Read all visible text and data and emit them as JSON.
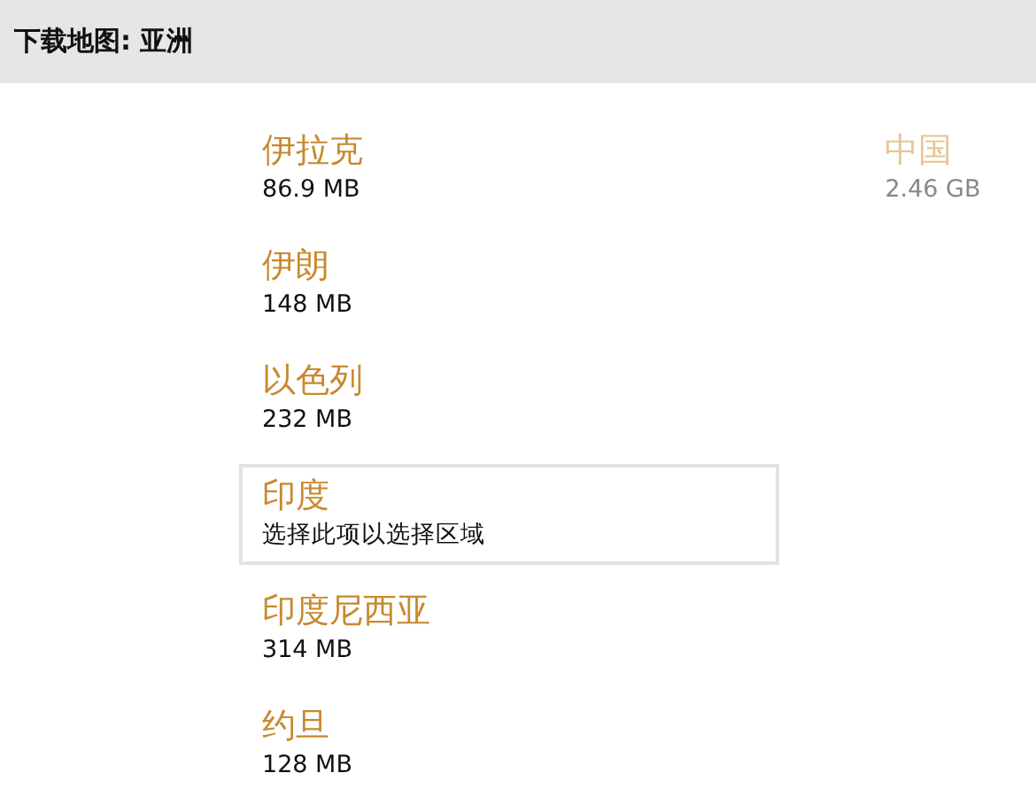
{
  "header": {
    "title": "下载地图: 亚洲"
  },
  "columns": [
    {
      "items": [
        {
          "name": "伊拉克",
          "detail": "86.9 MB",
          "selected": false,
          "disabled": false
        },
        {
          "name": "伊朗",
          "detail": "148 MB",
          "selected": false,
          "disabled": false
        },
        {
          "name": "以色列",
          "detail": "232 MB",
          "selected": false,
          "disabled": false
        },
        {
          "name": "印度",
          "detail": "选择此项以选择区域",
          "selected": true,
          "disabled": false
        },
        {
          "name": "印度尼西亚",
          "detail": "314 MB",
          "selected": false,
          "disabled": false
        },
        {
          "name": "约旦",
          "detail": "128 MB",
          "selected": false,
          "disabled": false
        }
      ]
    },
    {
      "items": [
        {
          "name": "中国",
          "detail": "2.46 GB",
          "selected": false,
          "disabled": true
        }
      ]
    }
  ]
}
